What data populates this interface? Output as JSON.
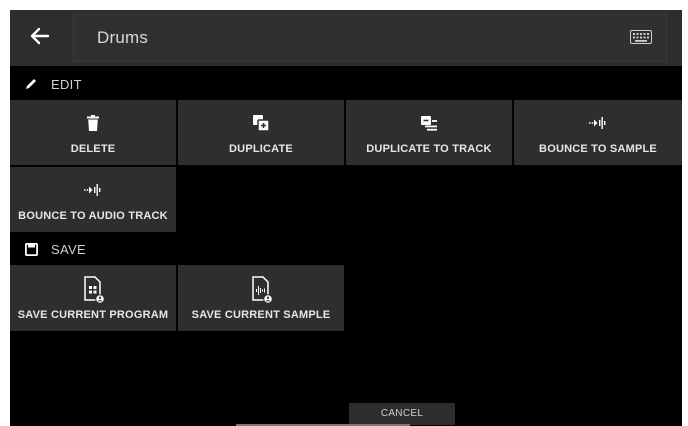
{
  "header": {
    "back_icon": "arrow-left-icon",
    "title": "Drums",
    "keyboard_icon": "keyboard-icon"
  },
  "edit_section": {
    "icon": "pencil-icon",
    "label": "EDIT",
    "tiles": [
      {
        "label": "DELETE",
        "icon": "trash-icon"
      },
      {
        "label": "DUPLICATE",
        "icon": "duplicate-icon"
      },
      {
        "label": "DUPLICATE TO TRACK",
        "icon": "duplicate-to-track-icon"
      },
      {
        "label": "BOUNCE TO SAMPLE",
        "icon": "bounce-icon"
      },
      {
        "label": "BOUNCE TO AUDIO TRACK",
        "icon": "bounce-icon"
      }
    ]
  },
  "save_section": {
    "icon": "floppy-disk-icon",
    "label": "SAVE",
    "tiles": [
      {
        "label": "SAVE CURRENT PROGRAM",
        "icon": "program-file-icon"
      },
      {
        "label": "SAVE CURRENT SAMPLE",
        "icon": "sample-file-icon"
      }
    ]
  },
  "footer": {
    "cancel_label": "CANCEL"
  },
  "colors": {
    "background": "#000000",
    "tile": "#2e2e2e",
    "header": "#2d2d2d",
    "text": "#e6e6e6"
  }
}
